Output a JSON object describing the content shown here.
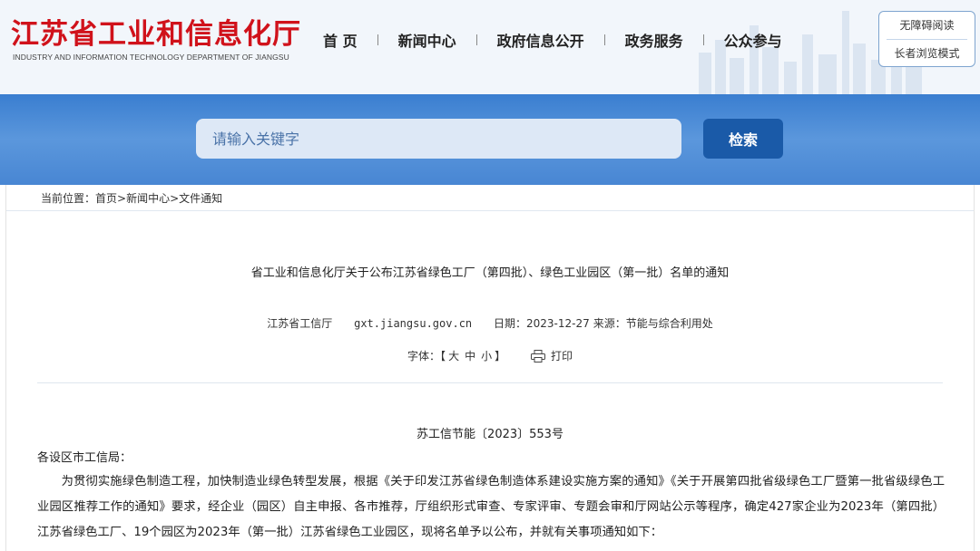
{
  "header": {
    "logo_cn": "江苏省工业和信息化厅",
    "logo_en": "INDUSTRY AND INFORMATION TECHNOLOGY DEPARTMENT OF JIANGSU",
    "nav": [
      "首 页",
      "新闻中心",
      "政府信息公开",
      "政务服务",
      "公众参与"
    ],
    "accessibility": {
      "barrier_free": "无障碍阅读",
      "elderly_mode": "长者浏览模式"
    }
  },
  "search": {
    "placeholder": "请输入关键字",
    "button": "检索"
  },
  "breadcrumb": {
    "prefix": "当前位置：",
    "items": [
      "首页",
      "新闻中心",
      "文件通知"
    ],
    "sep": ">"
  },
  "article": {
    "title": "省工业和信息化厅关于公布江苏省绿色工厂（第四批）、绿色工业园区（第一批）名单的通知",
    "meta": {
      "source_org": "江苏省工信厅",
      "site": "gxt.jiangsu.gov.cn",
      "date": "日期：2023-12-27",
      "origin": "来源：节能与综合利用处"
    },
    "tools": {
      "font_label": "字体：",
      "bracket_open": "【",
      "font_large": "大",
      "font_medium": "中",
      "font_small": "小",
      "bracket_close": "】",
      "print": "打印"
    },
    "doc_number": "苏工信节能〔2023〕553号",
    "addressee": "各设区市工信局：",
    "body": "为贯彻实施绿色制造工程，加快制造业绿色转型发展，根据《关于印发江苏省绿色制造体系建设实施方案的通知》《关于开展第四批省级绿色工厂暨第一批省级绿色工业园区推荐工作的通知》要求，经企业（园区）自主申报、各市推荐，厅组织形式审查、专家评审、专题会审和厅网站公示等程序，确定427家企业为2023年（第四批）江苏省绿色工厂、19个园区为2023年（第一批）江苏省绿色工业园区，现将名单予以公布，并就有关事项通知如下："
  },
  "colors": {
    "brand_red": "#d0121b",
    "banner_blue": "#4886d3",
    "button_blue": "#1a5aa8"
  }
}
